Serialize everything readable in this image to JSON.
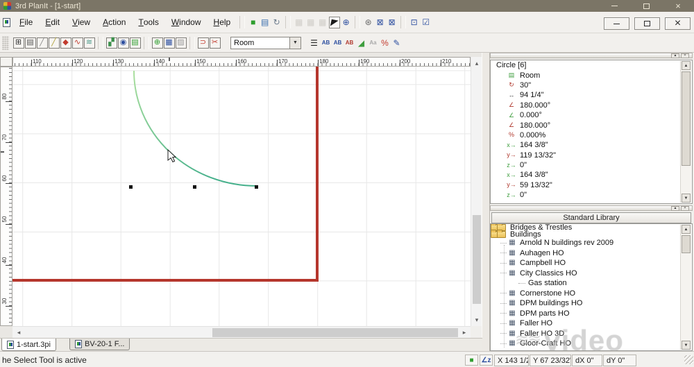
{
  "window": {
    "title": "3rd PlanIt - [1-start]"
  },
  "menu": {
    "items": [
      "File",
      "Edit",
      "View",
      "Action",
      "Tools",
      "Window",
      "Help"
    ]
  },
  "toolbar1": [
    {
      "sep": true
    },
    {
      "name": "view-3d-icon",
      "glyph": "■",
      "color": "#2f9e2f"
    },
    {
      "name": "textures-icon",
      "glyph": "▤",
      "color": "#3b6fae"
    },
    {
      "name": "refresh-icon",
      "glyph": "↻",
      "color": "#6b7b8c"
    },
    {
      "sep": true
    },
    {
      "name": "run-trains-icon",
      "glyph": "▦",
      "color": "#a8a49c",
      "disabled": true
    },
    {
      "name": "train-throttle-icon",
      "glyph": "▦",
      "color": "#a8a49c",
      "disabled": true
    },
    {
      "name": "train-consist-icon",
      "glyph": "▦",
      "color": "#a8a49c",
      "disabled": true
    },
    {
      "name": "select-tool-icon",
      "glyph": "◤",
      "color": "#1c1c1c",
      "active": true
    },
    {
      "name": "survey-tool-icon",
      "glyph": "⊕",
      "color": "#2d4fa0"
    },
    {
      "sep": true
    },
    {
      "name": "part-tool-icon",
      "glyph": "⊛",
      "color": "#6b6b6b"
    },
    {
      "name": "zoom-extents-icon",
      "glyph": "⊠",
      "color": "#2d4fa0"
    },
    {
      "name": "zoom-selection-icon",
      "glyph": "⊠",
      "color": "#2d4fa0"
    },
    {
      "sep": true
    },
    {
      "name": "window-view-icon",
      "glyph": "⊡",
      "color": "#2d4fa0"
    },
    {
      "name": "checklist-icon",
      "glyph": "☑",
      "color": "#2d4fa0"
    }
  ],
  "toolbar2": {
    "left": [
      {
        "name": "grid-snap-icon",
        "glyph": "⊞",
        "color": "#333333"
      },
      {
        "name": "ties-icon",
        "glyph": "▤",
        "color": "#555555"
      },
      {
        "name": "line-tool-icon",
        "glyph": "╱",
        "color": "#8a8a8a"
      },
      {
        "name": "track-tool-icon",
        "glyph": "╱",
        "color": "#b0a23a"
      },
      {
        "name": "switch-tool-icon",
        "glyph": "◆",
        "color": "#c23b2e"
      },
      {
        "name": "flex-track-icon",
        "glyph": "∿",
        "color": "#c23b2e"
      },
      {
        "name": "easement-icon",
        "glyph": "≋",
        "color": "#4a9a8a"
      },
      {
        "sep": true
      },
      {
        "name": "terrain-icon",
        "glyph": "▞",
        "color": "#3a8f4a"
      },
      {
        "name": "helix-icon",
        "glyph": "◉",
        "color": "#2d4fa0"
      },
      {
        "name": "layers-stack-icon",
        "glyph": "▤",
        "color": "#2f9e2f"
      },
      {
        "sep": true
      },
      {
        "name": "scenery-icon",
        "glyph": "⊕",
        "color": "#2f9e2f"
      },
      {
        "name": "table-icon",
        "glyph": "▦",
        "color": "#2d4fa0"
      },
      {
        "name": "background-image-icon",
        "glyph": "▨",
        "color": "#9a9a9a"
      },
      {
        "sep": true
      },
      {
        "name": "curve-tool-icon",
        "glyph": "⊃",
        "color": "#c23b2e"
      },
      {
        "name": "cut-tool-icon",
        "glyph": "✂",
        "color": "#c23b2e"
      }
    ],
    "layer_combo": "Room",
    "right": [
      {
        "name": "layer-list-icon",
        "glyph": "☰",
        "color": "#222222"
      },
      {
        "name": "layer-ab-1-icon",
        "glyph": "AB",
        "color": "#2d4fa0",
        "small": true
      },
      {
        "name": "layer-ab-2-icon",
        "glyph": "AB",
        "color": "#2d4fa0",
        "small": true
      },
      {
        "name": "layer-ab-3-icon",
        "glyph": "AB",
        "color": "#b0392e",
        "small": true
      },
      {
        "name": "grade-view-icon",
        "glyph": "◢",
        "color": "#3f9e3f"
      },
      {
        "name": "text-style-icon",
        "glyph": "Aa",
        "color": "#aaaaaa",
        "small": true
      },
      {
        "name": "grade-percent-icon",
        "glyph": "%",
        "color": "#c23b2e"
      },
      {
        "name": "object-properties-icon",
        "glyph": "✎",
        "color": "#2d4fa0"
      }
    ]
  },
  "rulers": {
    "top": [
      "110",
      "120",
      "130",
      "140",
      "150",
      "160",
      "170",
      "180",
      "190",
      "200",
      "210"
    ],
    "left": [
      "80",
      "70",
      "60",
      "50",
      "40",
      "30"
    ]
  },
  "properties": {
    "title": "Circle [6]",
    "rows": [
      {
        "icon": "layer-icon",
        "glyph": "▤",
        "color": "#3f9e3f",
        "value": "Room"
      },
      {
        "icon": "radius-icon",
        "glyph": "↻",
        "color": "#b0392e",
        "value": "30\""
      },
      {
        "icon": "length-icon",
        "glyph": "↔",
        "color": "#555555",
        "value": "94 1/4\""
      },
      {
        "icon": "arc-angle-icon",
        "glyph": "∠",
        "color": "#b0392e",
        "value": "180.000°"
      },
      {
        "icon": "start-angle-icon",
        "glyph": "∠",
        "color": "#3f9e3f",
        "value": "0.000°"
      },
      {
        "icon": "end-angle-icon",
        "glyph": "∠",
        "color": "#b0392e",
        "value": "180.000°"
      },
      {
        "icon": "grade-icon",
        "glyph": "%",
        "color": "#b0392e",
        "value": "0.000%"
      },
      {
        "icon": "x1-coord-icon",
        "glyph": "x→",
        "color": "#3f9e3f",
        "value": "164 3/8\""
      },
      {
        "icon": "y1-coord-icon",
        "glyph": "y→",
        "color": "#b0392e",
        "value": "119 13/32\""
      },
      {
        "icon": "z1-coord-icon",
        "glyph": "z→",
        "color": "#3f9e3f",
        "value": "0\""
      },
      {
        "icon": "x2-coord-icon",
        "glyph": "x→",
        "color": "#3f9e3f",
        "value": "164 3/8\""
      },
      {
        "icon": "y2-coord-icon",
        "glyph": "y→",
        "color": "#b0392e",
        "value": "59 13/32\""
      },
      {
        "icon": "z2-coord-icon",
        "glyph": "z→",
        "color": "#3f9e3f",
        "value": "0\""
      }
    ]
  },
  "library": {
    "header": "Standard Library",
    "items": [
      {
        "type": "folder",
        "label": "Bridges & Trestles"
      },
      {
        "type": "folder",
        "label": "Buildings"
      },
      {
        "type": "part",
        "label": "Arnold N buildings rev 2009"
      },
      {
        "type": "part",
        "label": "Auhagen HO"
      },
      {
        "type": "part",
        "label": "Campbell HO"
      },
      {
        "type": "part",
        "label": "City Classics HO"
      },
      {
        "type": "sub",
        "label": "Gas station"
      },
      {
        "type": "part",
        "label": "Cornerstone HO"
      },
      {
        "type": "part",
        "label": "DPM buildings HO"
      },
      {
        "type": "part",
        "label": "DPM parts HO"
      },
      {
        "type": "part",
        "label": "Faller HO"
      },
      {
        "type": "part",
        "label": "Faller HO 3D"
      },
      {
        "type": "part",
        "label": "Gloor-Craft HO"
      }
    ]
  },
  "tabs": [
    {
      "label": "1-start.3pi",
      "active": true
    },
    {
      "label": "BV-20-1 F...",
      "active": false
    }
  ],
  "status": {
    "message": "he Select Tool is active",
    "x": "X 143 1/2\"",
    "y": "Y 67 23/32\"",
    "dx": "dX 0\"",
    "dy": "dY 0\""
  },
  "watermark": {
    "mark": "≋≋",
    "text": "video"
  },
  "colors": {
    "titlebar": "#7b7566",
    "wall_red": "#b5372d",
    "arc_green_light": "#abdf9e",
    "arc_green_dark": "#45b08b",
    "accent_blue": "#2d4fa0"
  }
}
